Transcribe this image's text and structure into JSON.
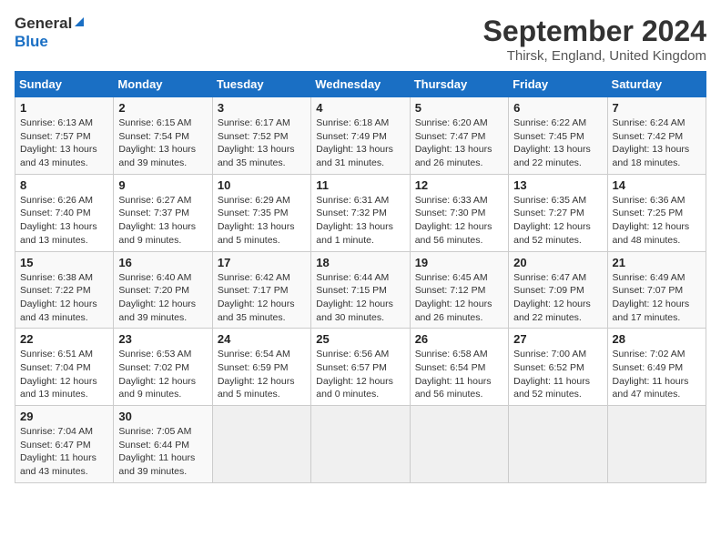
{
  "header": {
    "logo_general": "General",
    "logo_blue": "Blue",
    "month_title": "September 2024",
    "location": "Thirsk, England, United Kingdom"
  },
  "days_of_week": [
    "Sunday",
    "Monday",
    "Tuesday",
    "Wednesday",
    "Thursday",
    "Friday",
    "Saturday"
  ],
  "weeks": [
    [
      {
        "day": 1,
        "lines": [
          "Sunrise: 6:13 AM",
          "Sunset: 7:57 PM",
          "Daylight: 13 hours",
          "and 43 minutes."
        ]
      },
      {
        "day": 2,
        "lines": [
          "Sunrise: 6:15 AM",
          "Sunset: 7:54 PM",
          "Daylight: 13 hours",
          "and 39 minutes."
        ]
      },
      {
        "day": 3,
        "lines": [
          "Sunrise: 6:17 AM",
          "Sunset: 7:52 PM",
          "Daylight: 13 hours",
          "and 35 minutes."
        ]
      },
      {
        "day": 4,
        "lines": [
          "Sunrise: 6:18 AM",
          "Sunset: 7:49 PM",
          "Daylight: 13 hours",
          "and 31 minutes."
        ]
      },
      {
        "day": 5,
        "lines": [
          "Sunrise: 6:20 AM",
          "Sunset: 7:47 PM",
          "Daylight: 13 hours",
          "and 26 minutes."
        ]
      },
      {
        "day": 6,
        "lines": [
          "Sunrise: 6:22 AM",
          "Sunset: 7:45 PM",
          "Daylight: 13 hours",
          "and 22 minutes."
        ]
      },
      {
        "day": 7,
        "lines": [
          "Sunrise: 6:24 AM",
          "Sunset: 7:42 PM",
          "Daylight: 13 hours",
          "and 18 minutes."
        ]
      }
    ],
    [
      {
        "day": 8,
        "lines": [
          "Sunrise: 6:26 AM",
          "Sunset: 7:40 PM",
          "Daylight: 13 hours",
          "and 13 minutes."
        ]
      },
      {
        "day": 9,
        "lines": [
          "Sunrise: 6:27 AM",
          "Sunset: 7:37 PM",
          "Daylight: 13 hours",
          "and 9 minutes."
        ]
      },
      {
        "day": 10,
        "lines": [
          "Sunrise: 6:29 AM",
          "Sunset: 7:35 PM",
          "Daylight: 13 hours",
          "and 5 minutes."
        ]
      },
      {
        "day": 11,
        "lines": [
          "Sunrise: 6:31 AM",
          "Sunset: 7:32 PM",
          "Daylight: 13 hours",
          "and 1 minute."
        ]
      },
      {
        "day": 12,
        "lines": [
          "Sunrise: 6:33 AM",
          "Sunset: 7:30 PM",
          "Daylight: 12 hours",
          "and 56 minutes."
        ]
      },
      {
        "day": 13,
        "lines": [
          "Sunrise: 6:35 AM",
          "Sunset: 7:27 PM",
          "Daylight: 12 hours",
          "and 52 minutes."
        ]
      },
      {
        "day": 14,
        "lines": [
          "Sunrise: 6:36 AM",
          "Sunset: 7:25 PM",
          "Daylight: 12 hours",
          "and 48 minutes."
        ]
      }
    ],
    [
      {
        "day": 15,
        "lines": [
          "Sunrise: 6:38 AM",
          "Sunset: 7:22 PM",
          "Daylight: 12 hours",
          "and 43 minutes."
        ]
      },
      {
        "day": 16,
        "lines": [
          "Sunrise: 6:40 AM",
          "Sunset: 7:20 PM",
          "Daylight: 12 hours",
          "and 39 minutes."
        ]
      },
      {
        "day": 17,
        "lines": [
          "Sunrise: 6:42 AM",
          "Sunset: 7:17 PM",
          "Daylight: 12 hours",
          "and 35 minutes."
        ]
      },
      {
        "day": 18,
        "lines": [
          "Sunrise: 6:44 AM",
          "Sunset: 7:15 PM",
          "Daylight: 12 hours",
          "and 30 minutes."
        ]
      },
      {
        "day": 19,
        "lines": [
          "Sunrise: 6:45 AM",
          "Sunset: 7:12 PM",
          "Daylight: 12 hours",
          "and 26 minutes."
        ]
      },
      {
        "day": 20,
        "lines": [
          "Sunrise: 6:47 AM",
          "Sunset: 7:09 PM",
          "Daylight: 12 hours",
          "and 22 minutes."
        ]
      },
      {
        "day": 21,
        "lines": [
          "Sunrise: 6:49 AM",
          "Sunset: 7:07 PM",
          "Daylight: 12 hours",
          "and 17 minutes."
        ]
      }
    ],
    [
      {
        "day": 22,
        "lines": [
          "Sunrise: 6:51 AM",
          "Sunset: 7:04 PM",
          "Daylight: 12 hours",
          "and 13 minutes."
        ]
      },
      {
        "day": 23,
        "lines": [
          "Sunrise: 6:53 AM",
          "Sunset: 7:02 PM",
          "Daylight: 12 hours",
          "and 9 minutes."
        ]
      },
      {
        "day": 24,
        "lines": [
          "Sunrise: 6:54 AM",
          "Sunset: 6:59 PM",
          "Daylight: 12 hours",
          "and 5 minutes."
        ]
      },
      {
        "day": 25,
        "lines": [
          "Sunrise: 6:56 AM",
          "Sunset: 6:57 PM",
          "Daylight: 12 hours",
          "and 0 minutes."
        ]
      },
      {
        "day": 26,
        "lines": [
          "Sunrise: 6:58 AM",
          "Sunset: 6:54 PM",
          "Daylight: 11 hours",
          "and 56 minutes."
        ]
      },
      {
        "day": 27,
        "lines": [
          "Sunrise: 7:00 AM",
          "Sunset: 6:52 PM",
          "Daylight: 11 hours",
          "and 52 minutes."
        ]
      },
      {
        "day": 28,
        "lines": [
          "Sunrise: 7:02 AM",
          "Sunset: 6:49 PM",
          "Daylight: 11 hours",
          "and 47 minutes."
        ]
      }
    ],
    [
      {
        "day": 29,
        "lines": [
          "Sunrise: 7:04 AM",
          "Sunset: 6:47 PM",
          "Daylight: 11 hours",
          "and 43 minutes."
        ]
      },
      {
        "day": 30,
        "lines": [
          "Sunrise: 7:05 AM",
          "Sunset: 6:44 PM",
          "Daylight: 11 hours",
          "and 39 minutes."
        ]
      },
      null,
      null,
      null,
      null,
      null
    ]
  ]
}
